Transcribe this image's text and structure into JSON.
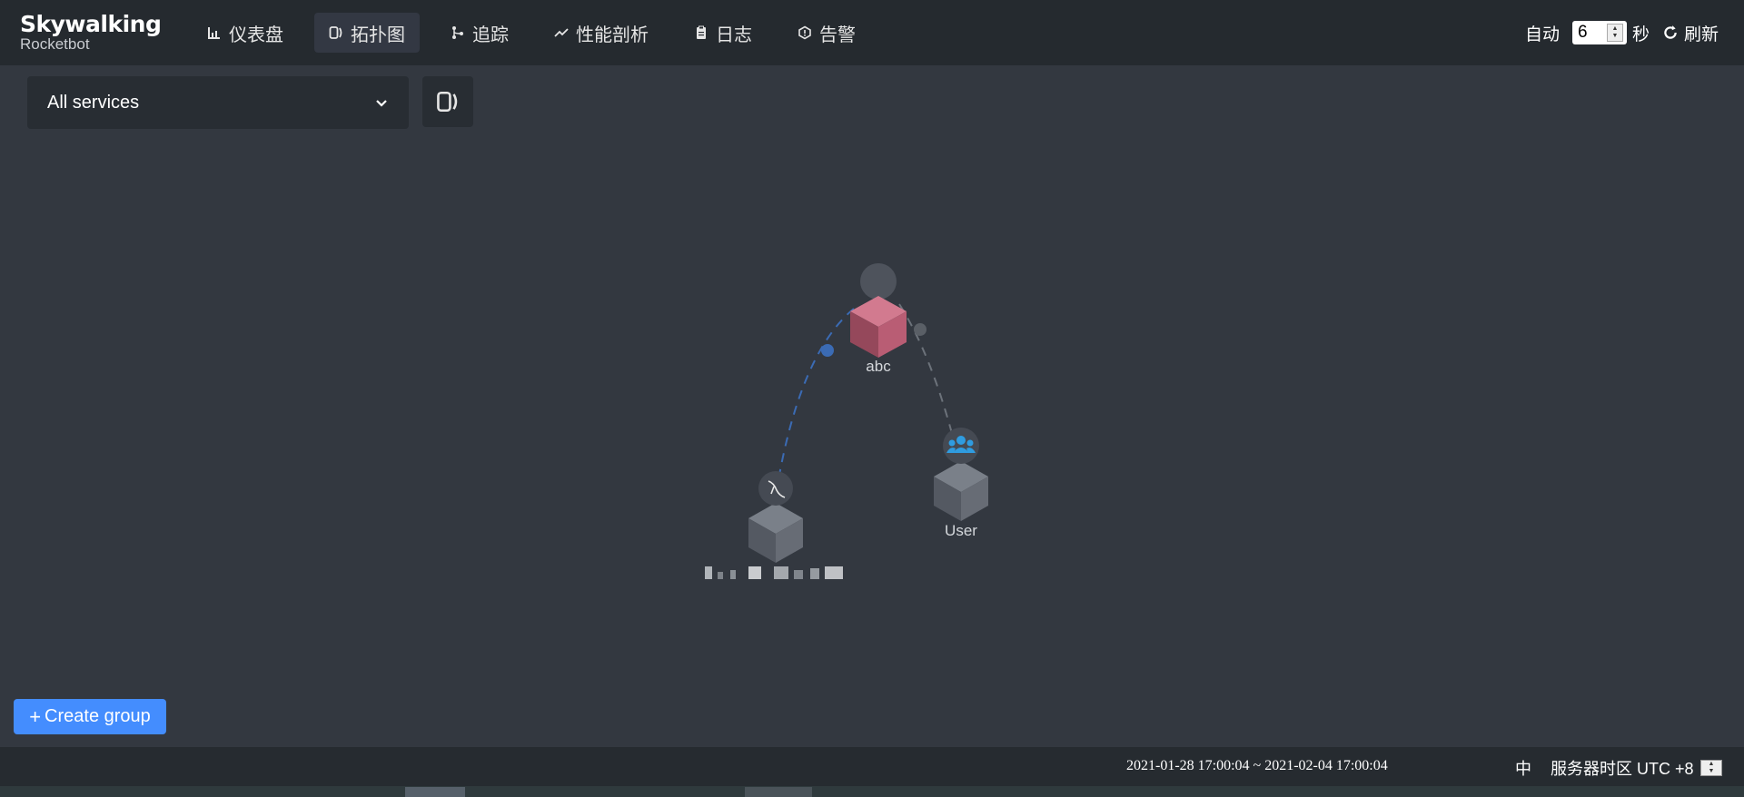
{
  "logo": {
    "main": "Skywalking",
    "sub": "Rocketbot"
  },
  "nav": [
    {
      "label": "仪表盘",
      "icon": "chart-icon"
    },
    {
      "label": "拓扑图",
      "icon": "topology-icon",
      "active": true
    },
    {
      "label": "追踪",
      "icon": "trace-icon"
    },
    {
      "label": "性能剖析",
      "icon": "trend-icon"
    },
    {
      "label": "日志",
      "icon": "clipboard-icon"
    },
    {
      "label": "告警",
      "icon": "alarm-icon"
    }
  ],
  "header_right": {
    "auto_label": "自动",
    "interval": "6",
    "unit": "秒",
    "refresh_label": "刷新"
  },
  "toolbar": {
    "service_select": "All services"
  },
  "topology": {
    "nodes": [
      {
        "label": "abc",
        "type": "service",
        "color": "#b95d74"
      },
      {
        "label": "User",
        "type": "user",
        "icon": "users-icon"
      },
      {
        "label": "",
        "type": "database",
        "icon": "mysql-icon"
      }
    ],
    "edges": [
      {
        "from": "abc",
        "to": "database",
        "color": "#3b6bb4",
        "style": "dashed"
      },
      {
        "from": "abc",
        "to": "User",
        "color": "#6c727a",
        "style": "dashed"
      }
    ]
  },
  "create_group_label": "Create group",
  "footer": {
    "time_range": "2021-01-28 17:00:04 ~ 2021-02-04 17:00:04",
    "lang": "中",
    "timezone": "服务器时区 UTC +8"
  },
  "colors": {
    "accent": "#448dfe",
    "background": "#333840",
    "topbar": "#252a2f"
  }
}
